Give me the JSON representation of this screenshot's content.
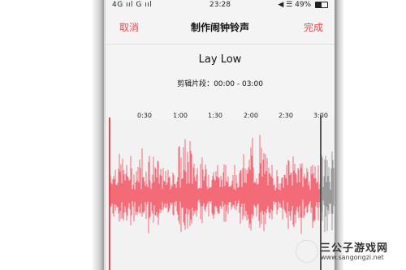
{
  "status_bar": {
    "network": "4G ııl  G ııl",
    "time": "23:28",
    "icons_right": "◀ ☰",
    "battery": "49%",
    "battery_level": 0.49
  },
  "nav": {
    "cancel_label": "取消",
    "title": "制作闹钟铃声",
    "done_label": "完成"
  },
  "song": {
    "title": "Lay Low",
    "trim_range": "剪辑片段：00:00 - 03:00"
  },
  "timeline": {
    "ticks": [
      "0:30",
      "1:00",
      "1:30",
      "2:00",
      "2:30",
      "3:00"
    ]
  },
  "waveform": {
    "selected_color": "#f26b77",
    "unselected_color": "#9a9a9a",
    "selection_start_seconds": 0,
    "selection_end_seconds": 180
  },
  "watermark": {
    "name": "三公子游戏网",
    "url": "www.sangongzi.net"
  }
}
